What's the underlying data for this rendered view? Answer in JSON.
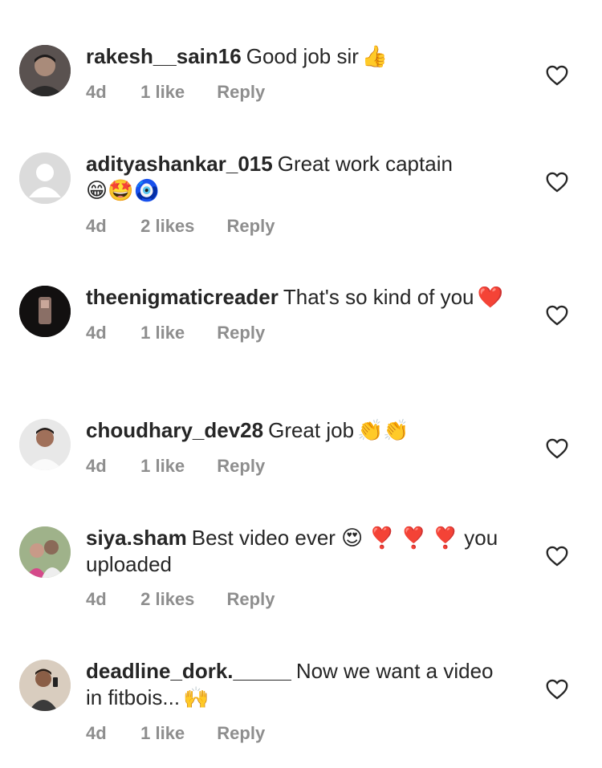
{
  "comments": [
    {
      "username": "rakesh__sain16",
      "text": "Good job sir",
      "emoji": "👍",
      "age": "4d",
      "likes": "1 like",
      "reply": "Reply"
    },
    {
      "username": "adityashankar_015",
      "text": "Great work captain",
      "emoji": "😁🤩🧿",
      "age": "4d",
      "likes": "2 likes",
      "reply": "Reply"
    },
    {
      "username": "theenigmaticreader",
      "text": "That's so kind of you",
      "emoji": "❤️",
      "age": "4d",
      "likes": "1 like",
      "reply": "Reply"
    },
    {
      "username": "choudhary_dev28",
      "text": "Great job",
      "emoji": "👏👏",
      "age": "4d",
      "likes": "1 like",
      "reply": "Reply"
    },
    {
      "username": "siya.sham",
      "text": "Best video ever 😍 ❣️ ❣️ ❣️ you uploaded",
      "emoji": "",
      "age": "4d",
      "likes": "2 likes",
      "reply": "Reply"
    },
    {
      "username": "deadline_dork._____",
      "text": "Now we want a video in fitbois...",
      "emoji": "🙌",
      "age": "4d",
      "likes": "1 like",
      "reply": "Reply"
    }
  ],
  "icons": {
    "like": "heart-outline-icon",
    "default_avatar": "default-avatar-icon"
  },
  "colors": {
    "text": "#262626",
    "secondary": "#8e8e8e",
    "background": "#ffffff"
  }
}
